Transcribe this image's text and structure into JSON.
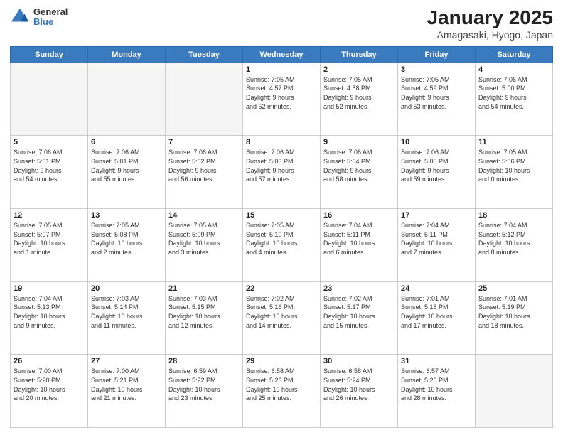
{
  "logo": {
    "general": "General",
    "blue": "Blue"
  },
  "title": {
    "month": "January 2025",
    "location": "Amagasaki, Hyogo, Japan"
  },
  "weekdays": [
    "Sunday",
    "Monday",
    "Tuesday",
    "Wednesday",
    "Thursday",
    "Friday",
    "Saturday"
  ],
  "weeks": [
    [
      {
        "day": "",
        "info": ""
      },
      {
        "day": "",
        "info": ""
      },
      {
        "day": "",
        "info": ""
      },
      {
        "day": "1",
        "info": "Sunrise: 7:05 AM\nSunset: 4:57 PM\nDaylight: 9 hours\nand 52 minutes."
      },
      {
        "day": "2",
        "info": "Sunrise: 7:05 AM\nSunset: 4:58 PM\nDaylight: 9 hours\nand 52 minutes."
      },
      {
        "day": "3",
        "info": "Sunrise: 7:05 AM\nSunset: 4:59 PM\nDaylight: 9 hours\nand 53 minutes."
      },
      {
        "day": "4",
        "info": "Sunrise: 7:06 AM\nSunset: 5:00 PM\nDaylight: 9 hours\nand 54 minutes."
      }
    ],
    [
      {
        "day": "5",
        "info": "Sunrise: 7:06 AM\nSunset: 5:01 PM\nDaylight: 9 hours\nand 54 minutes."
      },
      {
        "day": "6",
        "info": "Sunrise: 7:06 AM\nSunset: 5:01 PM\nDaylight: 9 hours\nand 55 minutes."
      },
      {
        "day": "7",
        "info": "Sunrise: 7:06 AM\nSunset: 5:02 PM\nDaylight: 9 hours\nand 56 minutes."
      },
      {
        "day": "8",
        "info": "Sunrise: 7:06 AM\nSunset: 5:03 PM\nDaylight: 9 hours\nand 57 minutes."
      },
      {
        "day": "9",
        "info": "Sunrise: 7:06 AM\nSunset: 5:04 PM\nDaylight: 9 hours\nand 58 minutes."
      },
      {
        "day": "10",
        "info": "Sunrise: 7:06 AM\nSunset: 5:05 PM\nDaylight: 9 hours\nand 59 minutes."
      },
      {
        "day": "11",
        "info": "Sunrise: 7:05 AM\nSunset: 5:06 PM\nDaylight: 10 hours\nand 0 minutes."
      }
    ],
    [
      {
        "day": "12",
        "info": "Sunrise: 7:05 AM\nSunset: 5:07 PM\nDaylight: 10 hours\nand 1 minute."
      },
      {
        "day": "13",
        "info": "Sunrise: 7:05 AM\nSunset: 5:08 PM\nDaylight: 10 hours\nand 2 minutes."
      },
      {
        "day": "14",
        "info": "Sunrise: 7:05 AM\nSunset: 5:09 PM\nDaylight: 10 hours\nand 3 minutes."
      },
      {
        "day": "15",
        "info": "Sunrise: 7:05 AM\nSunset: 5:10 PM\nDaylight: 10 hours\nand 4 minutes."
      },
      {
        "day": "16",
        "info": "Sunrise: 7:04 AM\nSunset: 5:11 PM\nDaylight: 10 hours\nand 6 minutes."
      },
      {
        "day": "17",
        "info": "Sunrise: 7:04 AM\nSunset: 5:11 PM\nDaylight: 10 hours\nand 7 minutes."
      },
      {
        "day": "18",
        "info": "Sunrise: 7:04 AM\nSunset: 5:12 PM\nDaylight: 10 hours\nand 8 minutes."
      }
    ],
    [
      {
        "day": "19",
        "info": "Sunrise: 7:04 AM\nSunset: 5:13 PM\nDaylight: 10 hours\nand 9 minutes."
      },
      {
        "day": "20",
        "info": "Sunrise: 7:03 AM\nSunset: 5:14 PM\nDaylight: 10 hours\nand 11 minutes."
      },
      {
        "day": "21",
        "info": "Sunrise: 7:03 AM\nSunset: 5:15 PM\nDaylight: 10 hours\nand 12 minutes."
      },
      {
        "day": "22",
        "info": "Sunrise: 7:02 AM\nSunset: 5:16 PM\nDaylight: 10 hours\nand 14 minutes."
      },
      {
        "day": "23",
        "info": "Sunrise: 7:02 AM\nSunset: 5:17 PM\nDaylight: 10 hours\nand 15 minutes."
      },
      {
        "day": "24",
        "info": "Sunrise: 7:01 AM\nSunset: 5:18 PM\nDaylight: 10 hours\nand 17 minutes."
      },
      {
        "day": "25",
        "info": "Sunrise: 7:01 AM\nSunset: 5:19 PM\nDaylight: 10 hours\nand 18 minutes."
      }
    ],
    [
      {
        "day": "26",
        "info": "Sunrise: 7:00 AM\nSunset: 5:20 PM\nDaylight: 10 hours\nand 20 minutes."
      },
      {
        "day": "27",
        "info": "Sunrise: 7:00 AM\nSunset: 5:21 PM\nDaylight: 10 hours\nand 21 minutes."
      },
      {
        "day": "28",
        "info": "Sunrise: 6:59 AM\nSunset: 5:22 PM\nDaylight: 10 hours\nand 23 minutes."
      },
      {
        "day": "29",
        "info": "Sunrise: 6:58 AM\nSunset: 5:23 PM\nDaylight: 10 hours\nand 25 minutes."
      },
      {
        "day": "30",
        "info": "Sunrise: 6:58 AM\nSunset: 5:24 PM\nDaylight: 10 hours\nand 26 minutes."
      },
      {
        "day": "31",
        "info": "Sunrise: 6:57 AM\nSunset: 5:26 PM\nDaylight: 10 hours\nand 28 minutes."
      },
      {
        "day": "",
        "info": ""
      }
    ]
  ]
}
